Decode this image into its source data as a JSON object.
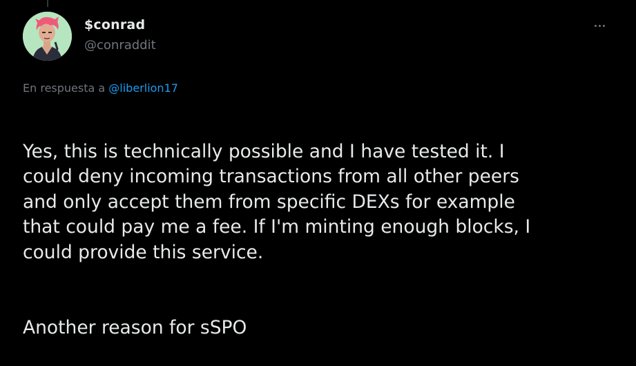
{
  "author": {
    "display_name": "$conrad",
    "handle": "@conraddit",
    "avatar_icon": "avatar-illustration-pink-hair"
  },
  "reply_context": {
    "prefix": "En respuesta a",
    "mention": "@liberlion17"
  },
  "tweet": {
    "paragraph_1": "Yes, this is technically possible and I have tested it. I\ncould deny incoming transactions from all other peers\nand only accept them from specific DEXs for example\nthat could pay me a fee. If I'm minting enough blocks, I\ncould provide this service.",
    "paragraph_2": "Another reason for sSPO"
  },
  "menu": {
    "more_icon": "more-horizontal-icon"
  },
  "colors": {
    "background": "#000000",
    "primary_text": "#e7e9ea",
    "secondary_text": "#71767b",
    "link": "#1d9bf0"
  }
}
